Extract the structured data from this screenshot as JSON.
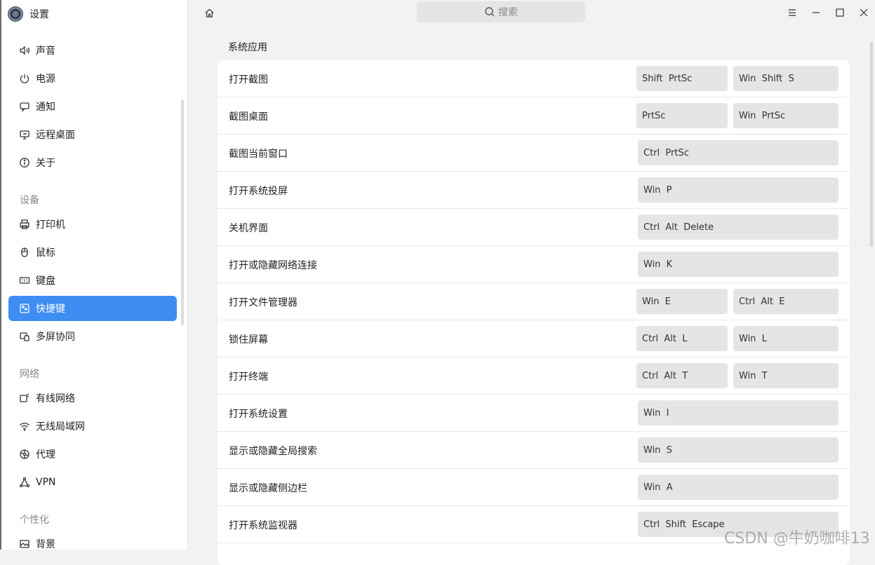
{
  "app": {
    "title": "设置"
  },
  "search": {
    "placeholder": "搜索"
  },
  "sidebar": {
    "items": [
      {
        "label": "声音",
        "icon": "speaker-icon"
      },
      {
        "label": "电源",
        "icon": "power-icon"
      },
      {
        "label": "通知",
        "icon": "message-icon"
      },
      {
        "label": "远程桌面",
        "icon": "remote-desktop-icon"
      },
      {
        "label": "关于",
        "icon": "info-icon"
      }
    ],
    "groups": {
      "devices": {
        "label": "设备",
        "items": [
          {
            "label": "打印机",
            "icon": "printer-icon"
          },
          {
            "label": "鼠标",
            "icon": "mouse-icon"
          },
          {
            "label": "键盘",
            "icon": "keyboard-icon"
          },
          {
            "label": "快捷键",
            "icon": "shortcut-icon",
            "active": true
          },
          {
            "label": "多屏协同",
            "icon": "multi-screen-icon"
          }
        ]
      },
      "network": {
        "label": "网络",
        "items": [
          {
            "label": "有线网络",
            "icon": "wired-network-icon"
          },
          {
            "label": "无线局域网",
            "icon": "wifi-icon"
          },
          {
            "label": "代理",
            "icon": "proxy-icon"
          },
          {
            "label": "VPN",
            "icon": "vpn-icon"
          }
        ]
      },
      "personalize": {
        "label": "个性化",
        "items": [
          {
            "label": "背景",
            "icon": "background-icon"
          }
        ]
      }
    }
  },
  "main": {
    "section_title": "系统应用",
    "shortcuts": [
      {
        "label": "打开截图",
        "keys": [
          "Shift  PrtSc",
          "Win  Shift  S"
        ]
      },
      {
        "label": "截图桌面",
        "keys": [
          "PrtSc",
          "Win  PrtSc"
        ]
      },
      {
        "label": "截图当前窗口",
        "keys": [
          "Ctrl  PrtSc"
        ]
      },
      {
        "label": "打开系统投屏",
        "keys": [
          "Win  P"
        ]
      },
      {
        "label": "关机界面",
        "keys": [
          "Ctrl  Alt  Delete"
        ]
      },
      {
        "label": "打开或隐藏网络连接",
        "keys": [
          "Win  K"
        ]
      },
      {
        "label": "打开文件管理器",
        "keys": [
          "Win  E",
          "Ctrl  Alt  E"
        ]
      },
      {
        "label": "锁住屏幕",
        "keys": [
          "Ctrl  Alt  L",
          "Win  L"
        ]
      },
      {
        "label": "打开终端",
        "keys": [
          "Ctrl  Alt  T",
          "Win  T"
        ]
      },
      {
        "label": "打开系统设置",
        "keys": [
          "Win  I"
        ]
      },
      {
        "label": "显示或隐藏全局搜索",
        "keys": [
          "Win  S"
        ]
      },
      {
        "label": "显示或隐藏侧边栏",
        "keys": [
          "Win  A"
        ]
      },
      {
        "label": "打开系统监视器",
        "keys": [
          "Ctrl  Shift  Escape"
        ]
      }
    ]
  },
  "watermark": "CSDN @牛奶咖啡13"
}
